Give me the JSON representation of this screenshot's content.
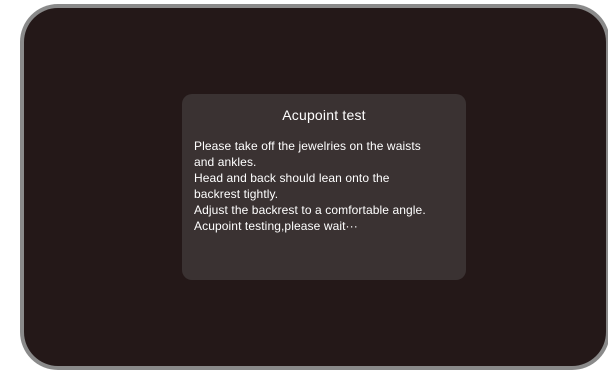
{
  "dialog": {
    "title": "Acupoint test",
    "lines": [
      "Please take off the jewelries on the waists",
      "and ankles.",
      "Head and back should lean onto the",
      "backrest tightly.",
      "Adjust the backrest to a comfortable angle.",
      "Acupoint testing,please wait···"
    ]
  },
  "colors": {
    "frame": "#8a8a8a",
    "screen": "#241818",
    "dialog": "#3a3232",
    "text": "#ffffff"
  }
}
